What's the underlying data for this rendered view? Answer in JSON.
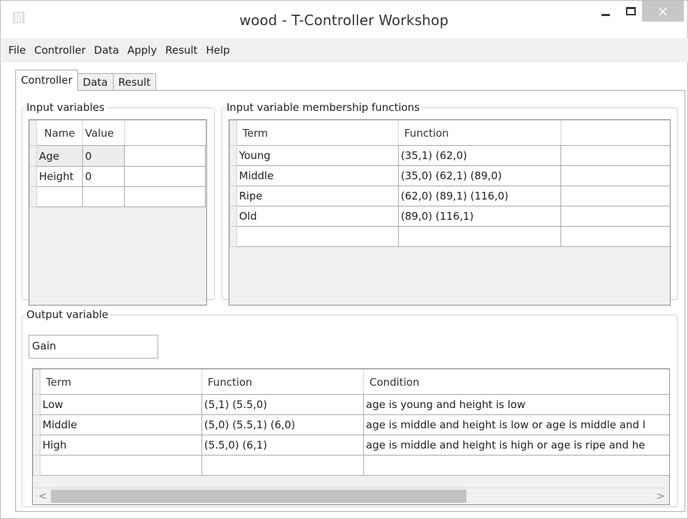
{
  "window": {
    "title": "wood - T-Controller Workshop",
    "close_glyph": "×"
  },
  "menu": [
    "File",
    "Controller",
    "Data",
    "Apply",
    "Result",
    "Help"
  ],
  "tabs": [
    "Controller",
    "Data",
    "Result"
  ],
  "input_variables": {
    "legend": "Input variables",
    "columns": [
      "Name",
      "Value"
    ],
    "rows": [
      {
        "name": "Age",
        "value": "0"
      },
      {
        "name": "Height",
        "value": "0"
      }
    ]
  },
  "input_membership": {
    "legend": "Input variable membership functions",
    "columns": [
      "Term",
      "Function"
    ],
    "rows": [
      {
        "term": "Young",
        "function": "(35,1) (62,0)"
      },
      {
        "term": "Middle",
        "function": "(35,0) (62,1) (89,0)"
      },
      {
        "term": "Ripe",
        "function": "(62,0) (89,1) (116,0)"
      },
      {
        "term": "Old",
        "function": "(89,0) (116,1)"
      }
    ]
  },
  "output_variable": {
    "legend": "Output variable",
    "name": "Gain",
    "columns": [
      "Term",
      "Function",
      "Condition"
    ],
    "rows": [
      {
        "term": "Low",
        "function": "(5,1) (5.5,0)",
        "condition": "age is young and height is low"
      },
      {
        "term": "Middle",
        "function": "(5,0) (5.5,1) (6,0)",
        "condition": "age is middle and height is low or age is middle and l"
      },
      {
        "term": "High",
        "function": "(5.5,0) (6,1)",
        "condition": "age is middle and height is high or age is ripe and he"
      }
    ]
  },
  "scrollbar": {
    "left_glyph": "<",
    "right_glyph": ">"
  },
  "colors": {
    "close_button": "#c7c7c7",
    "menubar": "#f0f0f0",
    "grid_border": "#8c8c8c"
  }
}
